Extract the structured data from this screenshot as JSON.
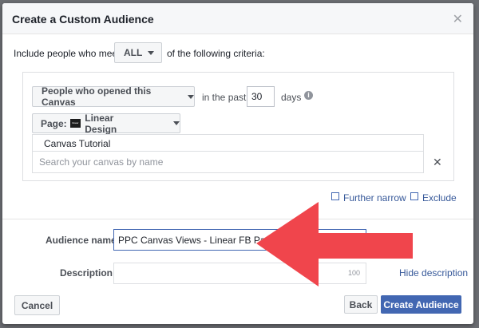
{
  "backdrop": {
    "right_text_top": "",
    "right_text_bottom": ""
  },
  "dialog": {
    "title": "Create a Custom Audience"
  },
  "criteria_line": {
    "prefix": "Include people who meet",
    "match_value": "ALL",
    "suffix": "of the following criteria:"
  },
  "rule": {
    "event_value": "People who opened this Canvas",
    "in_past_label": "in the past",
    "days_value": "30",
    "days_label": "days",
    "page_label": "Page:",
    "page_value": "Linear Design",
    "page_logo_text": "linear",
    "selected_canvas": "Canvas Tutorial",
    "search_placeholder": "Search your canvas by name"
  },
  "actions": {
    "further_narrow": "Further narrow",
    "exclude": "Exclude"
  },
  "form": {
    "audience_name_label": "Audience name",
    "audience_name_value": "PPC Canvas Views - Linear FB Page",
    "description_label": "Description",
    "description_char_limit": "100",
    "hide_description": "Hide description"
  },
  "footer": {
    "cancel": "Cancel",
    "back": "Back",
    "create": "Create Audience"
  },
  "colors": {
    "primary": "#4267b2",
    "link": "#365899",
    "annotation_arrow": "#f0454c"
  }
}
